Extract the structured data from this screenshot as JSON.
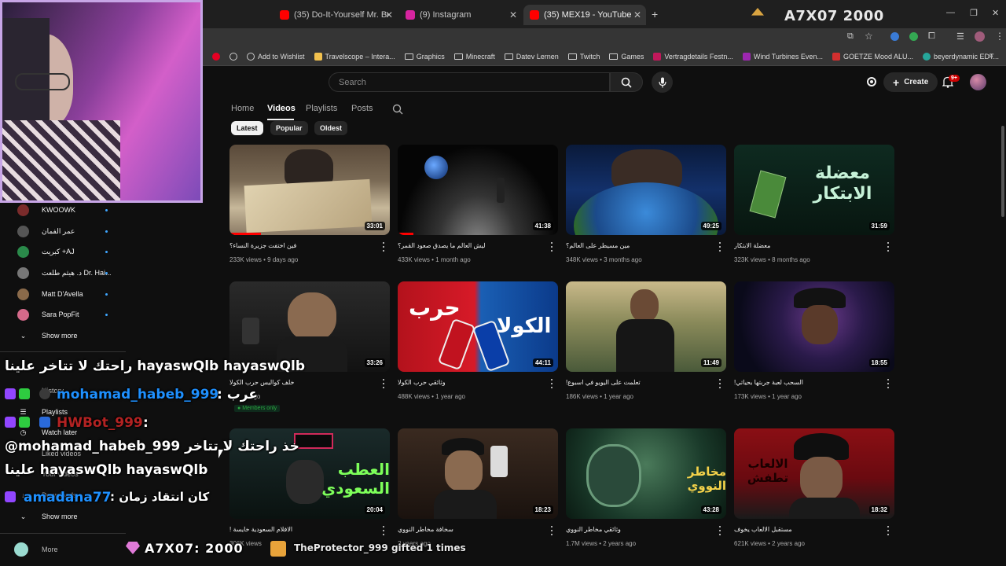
{
  "browser": {
    "tabs": [
      {
        "label": "(35) Do-It-Yourself Mr. Bean | E",
        "favicon_color": "#ff0000"
      },
      {
        "label": "(9) Instagram",
        "favicon_color": "#d6249f"
      },
      {
        "label": "(35) MEX19 - YouTube",
        "favicon_color": "#ff0000"
      }
    ],
    "new_tab": "+",
    "bookmarks": [
      {
        "label": "Add to Wishlist"
      },
      {
        "label": "Travelscope – Intera..."
      },
      {
        "label": "Graphics"
      },
      {
        "label": "Minecraft"
      },
      {
        "label": "Datev Lernen"
      },
      {
        "label": "Twitch"
      },
      {
        "label": "Games"
      },
      {
        "label": "Vertragdetails Festn..."
      },
      {
        "label": "Wind Turbines Even..."
      },
      {
        "label": "GOETZE Mood ALU..."
      },
      {
        "label": "beyerdynamic EDT..."
      }
    ],
    "overlay_title": "A7X07 2000"
  },
  "youtube": {
    "search_placeholder": "Search",
    "create_label": "Create",
    "notifications_badge": "9+",
    "channel_tabs": [
      "Home",
      "Videos",
      "Playlists",
      "Posts"
    ],
    "active_tab": "Videos",
    "chips": [
      "Latest",
      "Popular",
      "Oldest"
    ],
    "active_chip": "Latest",
    "videos": [
      {
        "title": "فين اختفت جزيرة النساء؟",
        "views": "233K views",
        "age": "9 days ago",
        "duration": "33:01"
      },
      {
        "title": "ليش العالم ما يصدق صعود القمر؟",
        "views": "433K views",
        "age": "1 month ago",
        "duration": "41:38"
      },
      {
        "title": "مين مسيطر على العالم؟",
        "views": "348K views",
        "age": "3 months ago",
        "duration": "49:25"
      },
      {
        "title": "معضلة الابتكار",
        "views": "323K views",
        "age": "8 months ago",
        "duration": "31:59"
      },
      {
        "title": "خلف كواليس حرب الكولا",
        "views": "",
        "age": "ago",
        "duration": "33:26",
        "members_only": "Members only"
      },
      {
        "title": "وثائقي حرب الكولا",
        "views": "488K views",
        "age": "1 year ago",
        "duration": "44:11"
      },
      {
        "title": "!تعلمت على اليويو في اسبوع",
        "views": "186K views",
        "age": "1 year ago",
        "duration": "11:49"
      },
      {
        "title": "!السحب لعبة جربتها بحياتي",
        "views": "173K views",
        "age": "1 year ago",
        "duration": "18:55"
      },
      {
        "title": "! الافلام السعودية خايسة",
        "views": "306K views",
        "age": "",
        "duration": "20:04"
      },
      {
        "title": "سخافة مخاطر النووي",
        "views": "",
        "age": "2 years ago",
        "duration": "18:23"
      },
      {
        "title": "وثائقي مخاطر النووي",
        "views": "1.7M views",
        "age": "2 years ago",
        "duration": "43:28"
      },
      {
        "title": "مستقبل الالعاب يخوف",
        "views": "621K views",
        "age": "2 years ago",
        "duration": "18:32"
      }
    ],
    "thumb_texts": {
      "innovation": "معضلة الابتكار",
      "cola_left": "حرب",
      "cola_right": "الكولا",
      "saudi": "العطب السعودي",
      "nuclear": "مخاطر النووي",
      "games": "الالعاب تطفش"
    },
    "sidebar": {
      "subscriptions": [
        {
          "name": "KWOOWK",
          "color": "#7a2b2b"
        },
        {
          "name": "عمر الفمان",
          "color": "#555"
        },
        {
          "name": "كبريت +AJ",
          "color": "#2a8a4a"
        },
        {
          "name": "د. هيثم طلعت Dr. Hai...",
          "color": "#777"
        },
        {
          "name": "Matt D'Avella",
          "color": "#8a6a4a"
        },
        {
          "name": "Sara PopFit",
          "color": "#d46a8a"
        }
      ],
      "show_more": "Show more",
      "you_items": [
        "History",
        "Playlists",
        "Watch later",
        "Liked videos",
        "Your videos",
        "Downloads"
      ],
      "show_more_2": "Show more",
      "more": "More"
    }
  },
  "chat": {
    "messages": [
      {
        "user": "",
        "text": "راحتك لا تتاخر علينا hayaswQlb hayaswQlb",
        "color": "#ffffff"
      },
      {
        "user": "mohamad_habeb_999",
        "text": "عرب",
        "color": "#1e90ff"
      },
      {
        "user": "HWBot_999",
        "text": "",
        "color": "#b22222"
      },
      {
        "user": "",
        "text": "@mohamad_habeb_999 خذ راحتك لا تتاخر",
        "color": "#ffffff"
      },
      {
        "user": "",
        "text": "علينا hayaswQlb hayaswQlb",
        "color": "#ffffff"
      },
      {
        "user": "amadana77",
        "text": "كان انتقاد زمان",
        "color": "#1e90ff"
      }
    ],
    "bottom_left": "A7X07: 2000",
    "bottom_right": "TheProtector_999 gifted 1 times"
  }
}
